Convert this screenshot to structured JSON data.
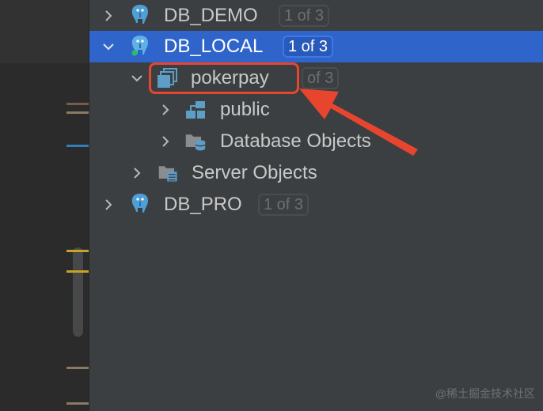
{
  "tree": {
    "db_demo": {
      "label": "DB_DEMO",
      "badge": "1 of 3",
      "icon": "postgresql-elephant-icon"
    },
    "db_local": {
      "label": "DB_LOCAL",
      "badge": "1 of 3",
      "icon": "postgresql-elephant-icon",
      "status": "connected",
      "status_color": "#22c35a"
    },
    "pokerpay": {
      "label": "pokerpay",
      "badge": "of 3",
      "icon": "database-stack-icon"
    },
    "public": {
      "label": "public",
      "icon": "schema-icon"
    },
    "database_objects": {
      "label": "Database Objects",
      "icon": "folder-database-icon"
    },
    "server_objects": {
      "label": "Server Objects",
      "icon": "folder-server-icon"
    },
    "db_pro": {
      "label": "DB_PRO",
      "badge": "1 of 3",
      "icon": "postgresql-elephant-icon"
    }
  },
  "colors": {
    "selection": "#2f65ca",
    "annotation": "#e8452f",
    "background": "#3c3f41",
    "postgres_blue": "#4f9fd6"
  },
  "watermark": "@稀土掘金技术社区"
}
